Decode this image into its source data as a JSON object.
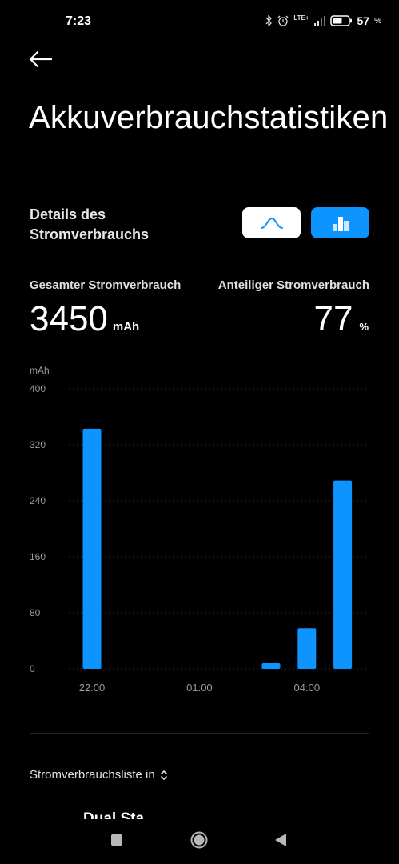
{
  "status_bar": {
    "time": "7:23",
    "network": "LTE+",
    "battery_percent": "57",
    "percent_sign": "%"
  },
  "page": {
    "title": "Akkuverbrauchstatistiken"
  },
  "details": {
    "title": "Details des Stromverbrauchs",
    "toggle_curve_icon": "curve-chart-icon",
    "toggle_bar_icon": "bar-chart-icon",
    "active_view": "bar"
  },
  "stats": {
    "total_label": "Gesamter Stromverbrauch",
    "total_value": "3450",
    "total_unit": "mAh",
    "share_label": "Anteiliger Stromverbrauch",
    "share_value": "77",
    "share_unit": "%"
  },
  "chart_data": {
    "type": "bar",
    "ylabel": "mAh",
    "ylim": [
      0,
      400
    ],
    "yticks": [
      400,
      320,
      240,
      160,
      80,
      0
    ],
    "xtick_labels": [
      "22:00",
      "01:00",
      "04:00"
    ],
    "categories": [
      "22:00",
      "23:00",
      "00:00",
      "01:00",
      "02:00",
      "03:00",
      "04:00",
      "05:00"
    ],
    "values": [
      343,
      0,
      0,
      0,
      0,
      8,
      58,
      269
    ],
    "bar_color": "#0d94ff",
    "grid": true
  },
  "list": {
    "selector_label": "Stromverbrauchsliste in",
    "partial_item": "Dual Sta..."
  },
  "colors": {
    "accent": "#0d94ff",
    "background": "#000000"
  }
}
